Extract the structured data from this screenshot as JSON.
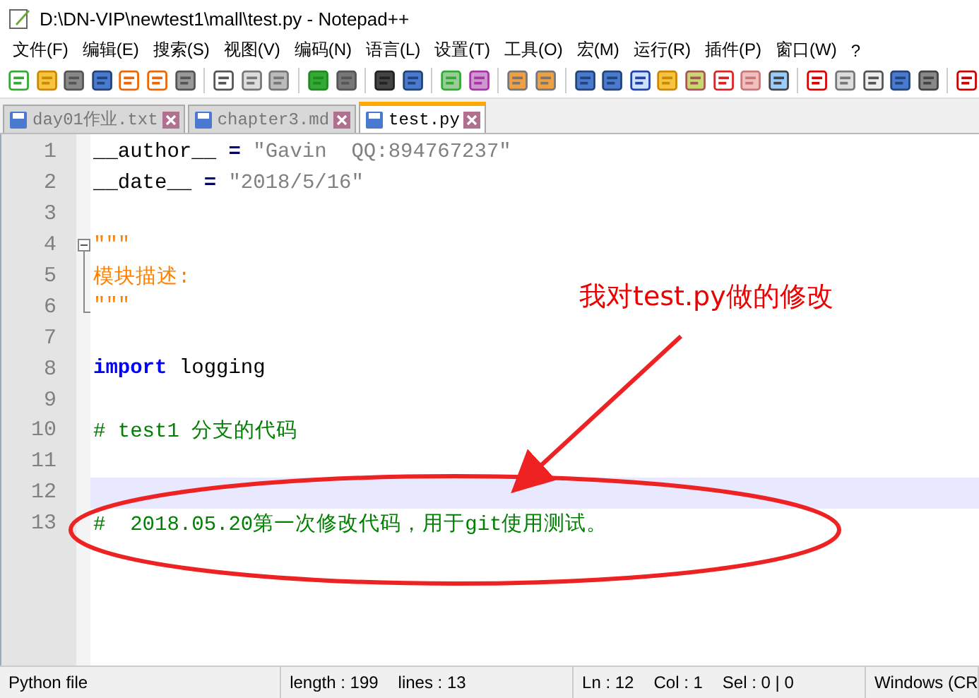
{
  "window": {
    "title": "D:\\DN-VIP\\newtest1\\mall\\test.py - Notepad++"
  },
  "menu": [
    "文件(F)",
    "编辑(E)",
    "搜索(S)",
    "视图(V)",
    "编码(N)",
    "语言(L)",
    "设置(T)",
    "工具(O)",
    "宏(M)",
    "运行(R)",
    "插件(P)",
    "窗口(W)",
    "?"
  ],
  "tabs": [
    {
      "label": "day01作业.txt",
      "selected": false
    },
    {
      "label": "chapter3.md",
      "selected": false
    },
    {
      "label": "test.py",
      "selected": true
    }
  ],
  "editor": {
    "lines": [
      {
        "number": "1",
        "current": false,
        "kind": "plain",
        "segments": [
          {
            "kind": "text",
            "text": "__author__ "
          },
          {
            "kind": "operator",
            "text": "="
          },
          {
            "kind": "string",
            "text": " \"Gavin  QQ:894767237\""
          }
        ]
      },
      {
        "number": "2",
        "current": false,
        "kind": "plain",
        "segments": [
          {
            "kind": "text",
            "text": "__date__ "
          },
          {
            "kind": "operator",
            "text": "="
          },
          {
            "kind": "string",
            "text": " \"2018/5/16\""
          }
        ]
      },
      {
        "number": "3",
        "current": false,
        "kind": "plain"
      },
      {
        "number": "4",
        "current": false,
        "kind": "fold_start",
        "segments": [
          {
            "kind": "docstring",
            "text": "\"\"\""
          }
        ]
      },
      {
        "number": "5",
        "current": false,
        "kind": "fold_middle",
        "segments": [
          {
            "kind": "docstring",
            "text": "模块描述:"
          }
        ]
      },
      {
        "number": "6",
        "current": false,
        "kind": "fold_end",
        "segments": [
          {
            "kind": "docstring",
            "text": "\"\"\""
          }
        ]
      },
      {
        "number": "7",
        "current": false,
        "kind": "plain"
      },
      {
        "number": "8",
        "current": false,
        "kind": "plain",
        "segments": [
          {
            "kind": "keyword",
            "text": "import"
          },
          {
            "kind": "text",
            "text": " logging"
          }
        ]
      },
      {
        "number": "9",
        "current": false,
        "kind": "plain"
      },
      {
        "number": "10",
        "current": false,
        "kind": "plain",
        "segments": [
          {
            "kind": "comment",
            "text": "# test1 分支的代码"
          }
        ]
      },
      {
        "number": "11",
        "current": false,
        "kind": "plain"
      },
      {
        "number": "12",
        "current": true,
        "kind": "plain"
      },
      {
        "number": "13",
        "current": false,
        "kind": "plain",
        "segments": [
          {
            "kind": "comment",
            "text": "#  2018.05.20第一次修改代码，用于git使用测试。"
          }
        ]
      }
    ]
  },
  "annotation": {
    "text": "我对test.py做的修改"
  },
  "status_bar": {
    "file_type": "Python file",
    "length": "length : 199",
    "lines": "lines : 13",
    "ln": "Ln : 12",
    "col": "Col : 1",
    "sel": "Sel : 0 | 0",
    "eol": "Windows (CR"
  }
}
